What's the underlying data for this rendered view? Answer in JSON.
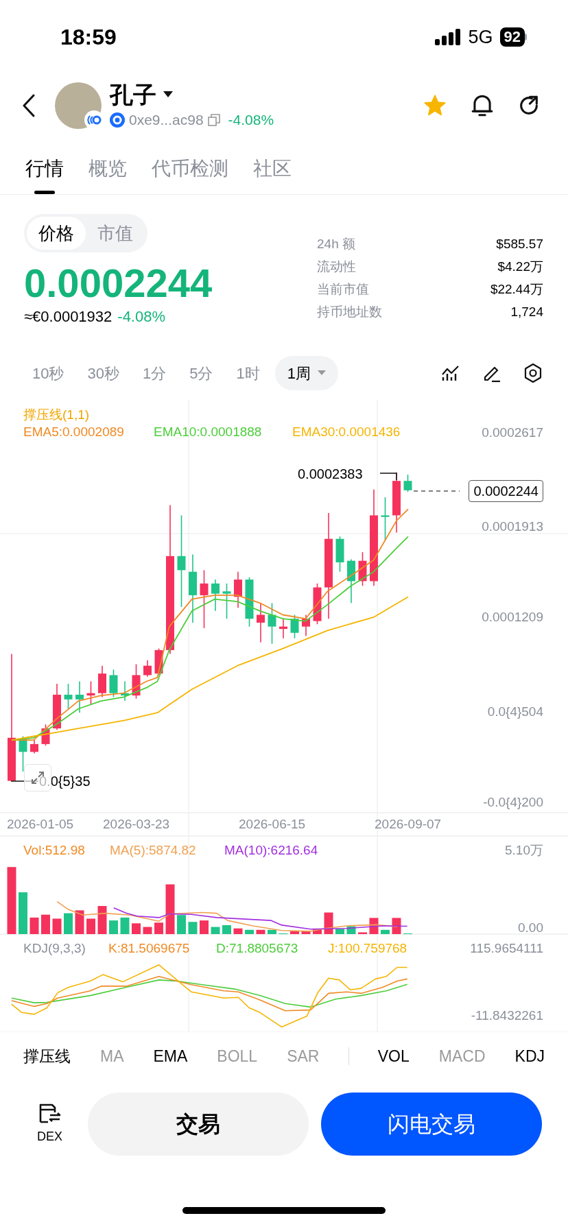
{
  "status_bar": {
    "time": "18:59",
    "network": "5G",
    "battery": "92"
  },
  "header": {
    "token_name": "孔子",
    "address": "0xe9...ac98",
    "change": "-4.08%",
    "favorite": true
  },
  "tabs": [
    {
      "label": "行情",
      "selected": true
    },
    {
      "label": "概览",
      "selected": false
    },
    {
      "label": "代币检测",
      "selected": false
    },
    {
      "label": "社区",
      "selected": false
    }
  ],
  "price_toggle": [
    {
      "label": "价格",
      "selected": true
    },
    {
      "label": "市值",
      "selected": false
    }
  ],
  "price": {
    "value": "0.0002244",
    "fiat": "≈€0.0001932",
    "change": "-4.08%"
  },
  "stats": [
    {
      "label": "24h 额",
      "value": "$585.57"
    },
    {
      "label": "流动性",
      "value": "$4.22万"
    },
    {
      "label": "当前市值",
      "value": "$22.44万"
    },
    {
      "label": "持币地址数",
      "value": "1,724"
    }
  ],
  "intervals": [
    {
      "label": "10秒",
      "selected": false,
      "dropdown": false
    },
    {
      "label": "30秒",
      "selected": false,
      "dropdown": false
    },
    {
      "label": "1分",
      "selected": false,
      "dropdown": false
    },
    {
      "label": "5分",
      "selected": false,
      "dropdown": false
    },
    {
      "label": "1时",
      "selected": false,
      "dropdown": false
    },
    {
      "label": "1周",
      "selected": true,
      "dropdown": true
    }
  ],
  "chart": {
    "indicator_title": "撑压线(1,1)",
    "legend": [
      {
        "text": "EMA5:0.0002089",
        "color": "#f08a24"
      },
      {
        "text": "EMA10:0.0001888",
        "color": "#4ccd3a"
      },
      {
        "text": "EMA30:0.0001436",
        "color": "#f5b400"
      }
    ],
    "y_labels": [
      "0.0002617",
      "0.0001913",
      "0.0001209",
      "0.0{4}504",
      "-0.0{4}200"
    ],
    "high_marker": "0.0002383",
    "current_price": "0.0002244",
    "low_marker": "0.0{5}35",
    "dates": [
      "2026-01-05",
      "2026-03-23",
      "2026-06-15",
      "2026-09-07"
    ]
  },
  "volume": {
    "legend": [
      {
        "text": "Vol:512.98",
        "color": "#f08a24"
      },
      {
        "text": "MA(5):5874.82",
        "color": "#f0a050"
      },
      {
        "text": "MA(10):6216.64",
        "color": "#a22ee0"
      }
    ],
    "y_labels": [
      "5.10万",
      "0.00"
    ]
  },
  "kdj": {
    "legend": [
      {
        "text": "KDJ(9,3,3)",
        "color": "#8a8f99"
      },
      {
        "text": "K:81.5069675",
        "color": "#f08a24"
      },
      {
        "text": "D:71.8805673",
        "color": "#4ccd3a"
      },
      {
        "text": "J:100.759768",
        "color": "#f5b400"
      }
    ],
    "y_labels": [
      "115.9654111",
      "-11.8432261"
    ]
  },
  "main_indicators": [
    {
      "label": "撑压线",
      "selected": true
    },
    {
      "label": "MA",
      "selected": false
    },
    {
      "label": "EMA",
      "selected": true
    },
    {
      "label": "BOLL",
      "selected": false
    },
    {
      "label": "SAR",
      "selected": false
    }
  ],
  "sub_indicators": [
    {
      "label": "VOL",
      "selected": true
    },
    {
      "label": "MACD",
      "selected": false
    },
    {
      "label": "KDJ",
      "selected": true
    }
  ],
  "bottom_bar": {
    "dex_label": "DEX",
    "trade_button": "交易",
    "flash_trade_button": "闪电交易"
  }
}
